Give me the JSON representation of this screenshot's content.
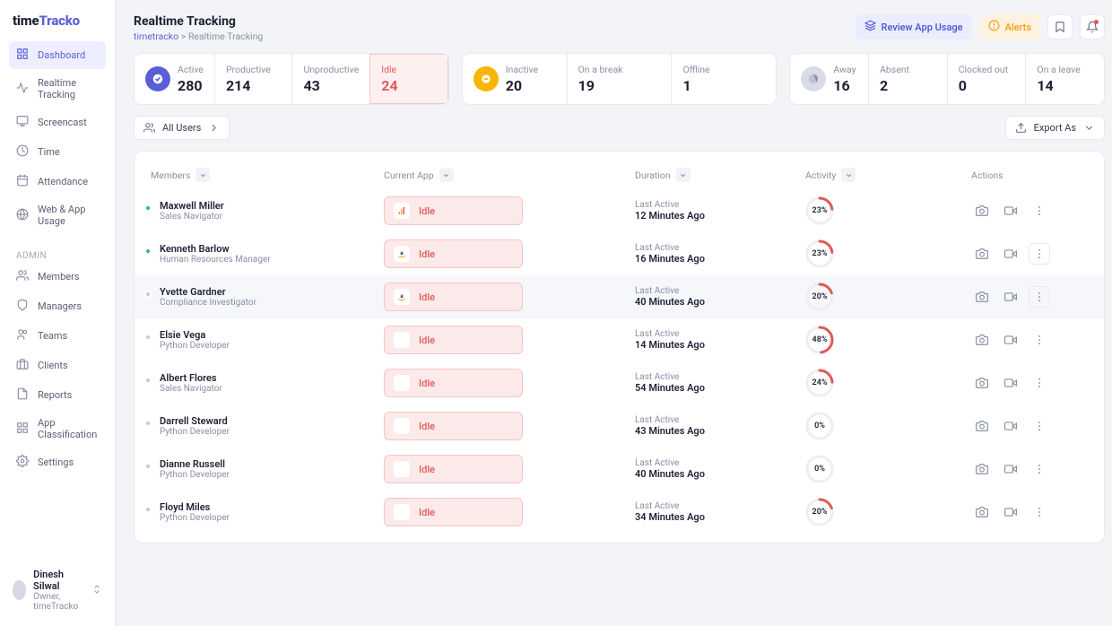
{
  "brand": {
    "part1": "time",
    "part2": "Tracko"
  },
  "nav": {
    "primary": [
      {
        "label": "Dashboard",
        "active": true,
        "icon": "grid"
      },
      {
        "label": "Realtime Tracking",
        "icon": "activity"
      },
      {
        "label": "Screencast",
        "icon": "monitor"
      },
      {
        "label": "Time",
        "icon": "clock"
      },
      {
        "label": "Attendance",
        "icon": "calendar"
      },
      {
        "label": "Web & App Usage",
        "icon": "globe"
      }
    ],
    "admin_label": "ADMIN",
    "admin": [
      {
        "label": "Members",
        "icon": "users"
      },
      {
        "label": "Managers",
        "icon": "shield"
      },
      {
        "label": "Teams",
        "icon": "team"
      },
      {
        "label": "Clients",
        "icon": "briefcase"
      },
      {
        "label": "Reports",
        "icon": "report"
      },
      {
        "label": "App Classification",
        "icon": "apps"
      },
      {
        "label": "Settings",
        "icon": "settings"
      }
    ]
  },
  "sidebar_user": {
    "name": "Dinesh Silwal",
    "role": "Owner, timeTracko"
  },
  "header": {
    "title": "Realtime Tracking",
    "crumb_root": "timetracko",
    "crumb_sep": ">",
    "crumb_current": "Realtime Tracking",
    "review": "Review App Usage",
    "alerts": "Alerts"
  },
  "stats": {
    "group1": [
      {
        "label": "Active",
        "value": "280",
        "icon": "active"
      },
      {
        "label": "Productive",
        "value": "214"
      },
      {
        "label": "Unproductive",
        "value": "43"
      },
      {
        "label": "Idle",
        "value": "24",
        "idle": true
      }
    ],
    "group2": [
      {
        "label": "Inactive",
        "value": "20",
        "icon": "inactive"
      },
      {
        "label": "On a break",
        "value": "19"
      },
      {
        "label": "Offline",
        "value": "1"
      }
    ],
    "group3": [
      {
        "label": "Away",
        "value": "16",
        "icon": "away"
      },
      {
        "label": "Absent",
        "value": "2"
      },
      {
        "label": "Clocked out",
        "value": "0"
      },
      {
        "label": "On a leave",
        "value": "14"
      }
    ]
  },
  "filters": {
    "all_users": "All Users",
    "export": "Export As"
  },
  "columns": {
    "members": "Members",
    "app": "Current App",
    "duration": "Duration",
    "activity": "Activity",
    "actions": "Actions"
  },
  "idle_label": "Idle",
  "last_active_label": "Last Active",
  "rows": [
    {
      "name": "Maxwell Miller",
      "sub": "Sales Navigator",
      "status": "green",
      "app_icon": "analytics",
      "duration": "12 Minutes Ago",
      "activity": 23
    },
    {
      "name": "Kenneth Barlow",
      "sub": "Human Resources Manager",
      "status": "green",
      "app_icon": "amazon",
      "duration": "16 Minutes Ago",
      "activity": 23,
      "menu_box": true
    },
    {
      "name": "Yvette Gardner",
      "sub": "Compliance Investigator",
      "status": "grey",
      "app_icon": "amazon",
      "duration": "40 Minutes Ago",
      "activity": 20,
      "highlight": true,
      "menu_box": true
    },
    {
      "name": "Elsie Vega",
      "sub": "Python Developer",
      "status": "grey",
      "app_icon": "blank",
      "duration": "14 Minutes Ago",
      "activity": 48
    },
    {
      "name": "Albert Flores",
      "sub": "Sales Navigator",
      "status": "grey",
      "app_icon": "blank",
      "duration": "54 Minutes Ago",
      "activity": 24
    },
    {
      "name": "Darrell Steward",
      "sub": "Python Developer",
      "status": "grey",
      "app_icon": "blank",
      "duration": "43 Minutes Ago",
      "activity": 0
    },
    {
      "name": "Dianne Russell",
      "sub": "Python Developer",
      "status": "grey",
      "app_icon": "blank",
      "duration": "40 Minutes Ago",
      "activity": 0
    },
    {
      "name": "Floyd Miles",
      "sub": "Python Developer",
      "status": "grey",
      "app_icon": "blank",
      "duration": "34 Minutes Ago",
      "activity": 20
    }
  ]
}
